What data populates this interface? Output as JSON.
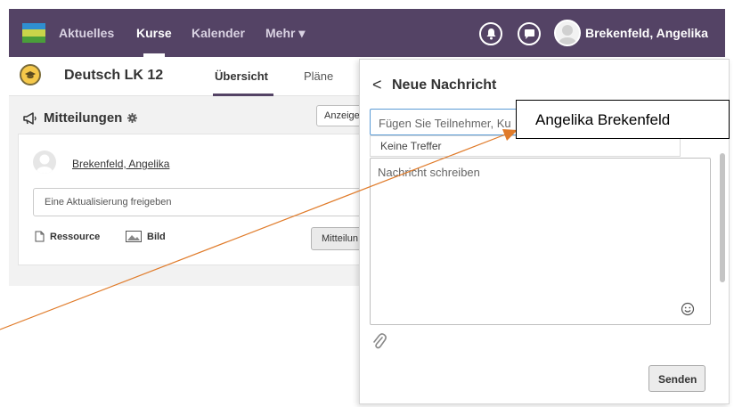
{
  "nav": {
    "items": [
      {
        "label": "Aktuelles"
      },
      {
        "label": "Kurse"
      },
      {
        "label": "Kalender"
      },
      {
        "label": "Mehr ▾"
      }
    ],
    "user_name": "Brekenfeld, Angelika"
  },
  "course": {
    "title": "Deutsch LK 12",
    "tabs": [
      {
        "label": "Übersicht"
      },
      {
        "label": "Pläne"
      }
    ]
  },
  "updates": {
    "title": "Mitteilungen",
    "show_button": "Anzeige",
    "author": "Brekenfeld, Angelika",
    "share_placeholder": "Eine Aktualisierung freigeben",
    "resource_label": "Ressource",
    "image_label": "Bild",
    "post_button": "Mitteilun"
  },
  "message_panel": {
    "back_glyph": "<",
    "title": "Neue Nachricht",
    "recipient_placeholder": "Fügen Sie Teilnehmer, Ku",
    "no_results": "Keine Treffer",
    "message_placeholder": "Nachricht schreiben",
    "send_button": "Senden"
  },
  "annotation": {
    "text": "Angelika Brekenfeld",
    "color": "#e07b2a"
  },
  "colors": {
    "topbar": "#544365",
    "accent": "#544365"
  }
}
